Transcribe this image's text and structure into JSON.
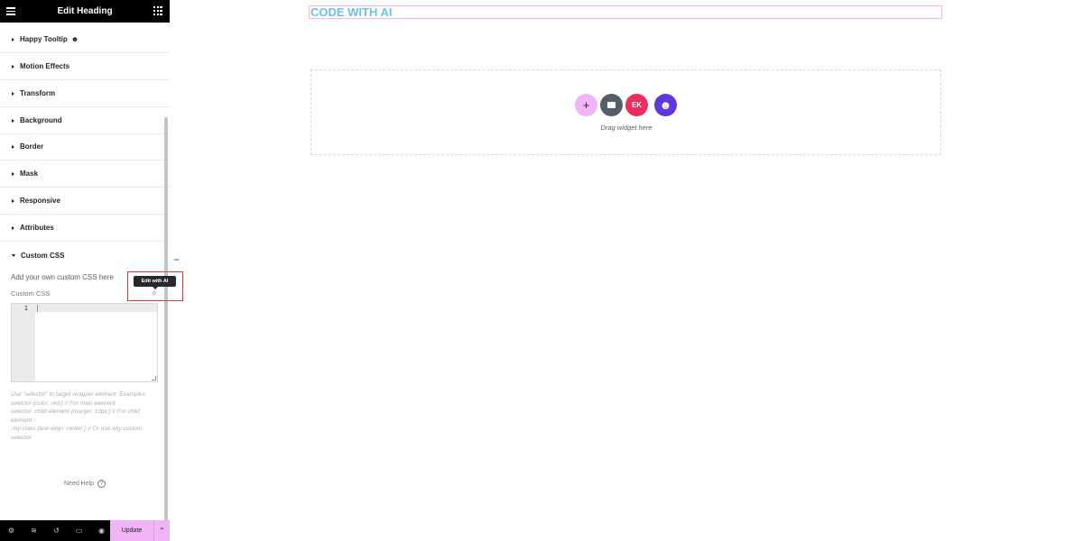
{
  "header": {
    "title": "Edit Heading",
    "menu_icon": "hamburger-icon",
    "apps_icon": "grid-icon"
  },
  "sections": [
    {
      "label": "Happy Tooltip",
      "expanded": false,
      "badge_icon": "happy-addons-icon"
    },
    {
      "label": "Motion Effects",
      "expanded": false
    },
    {
      "label": "Transform",
      "expanded": false
    },
    {
      "label": "Background",
      "expanded": false
    },
    {
      "label": "Border",
      "expanded": false
    },
    {
      "label": "Mask",
      "expanded": false
    },
    {
      "label": "Responsive",
      "expanded": false
    },
    {
      "label": "Attributes",
      "expanded": false
    },
    {
      "label": "Custom CSS",
      "expanded": true
    }
  ],
  "custom_css": {
    "description": "Add your own custom CSS here",
    "field_label": "Custom CSS",
    "ai_tooltip": "Edit with AI",
    "line_number": "1",
    "value": "",
    "help_lines": [
      "Use \"selector\" to target wrapper element. Examples:",
      "selector {color: red;} // For main element",
      "selector .child-element {margin: 10px;} // For child element",
      ".my-class {text-align: center;} // Or use any custom selector"
    ]
  },
  "need_help": "Need Help",
  "footer": {
    "icons": [
      "settings-icon",
      "layers-icon",
      "history-icon",
      "responsive-icon",
      "preview-icon"
    ],
    "update_label": "Update"
  },
  "canvas": {
    "heading": "CODE WITH AI",
    "drop_text": "Drag widget here",
    "buttons": [
      {
        "name": "add-section",
        "glyph": "+",
        "color": "#f1b4f6"
      },
      {
        "name": "template-library",
        "glyph": "▬",
        "color": "#555d66"
      },
      {
        "name": "elementskit",
        "glyph": "EK",
        "color": "#ed2b5c"
      },
      {
        "name": "happy-addons",
        "glyph": "☺",
        "color": "#5d38dc"
      }
    ]
  },
  "colors": {
    "accent": "#f1b4f6",
    "heading": "#6ec1e4",
    "highlight": "#e0393e"
  }
}
